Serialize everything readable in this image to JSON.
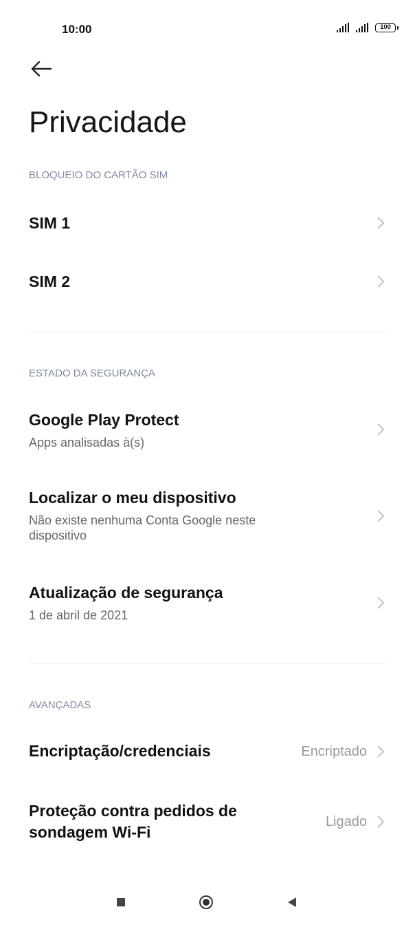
{
  "status_bar": {
    "time": "10:00",
    "battery": "100"
  },
  "page": {
    "title": "Privacidade"
  },
  "sections": {
    "sim_lock": {
      "header": "BLOQUEIO DO CARTÃO SIM",
      "items": [
        {
          "title": "SIM 1"
        },
        {
          "title": "SIM 2"
        }
      ]
    },
    "security_status": {
      "header": "ESTADO DA SEGURANÇA",
      "items": [
        {
          "title": "Google Play Protect",
          "subtitle": "Apps analisadas à(s)"
        },
        {
          "title": "Localizar o meu dispositivo",
          "subtitle": "Não existe nenhuma Conta Google neste dispositivo"
        },
        {
          "title": "Atualização de segurança",
          "subtitle": "1 de abril de 2021"
        }
      ]
    },
    "advanced": {
      "header": "AVANÇADAS",
      "items": [
        {
          "title": "Encriptação/credenciais",
          "value": "Encriptado"
        },
        {
          "title_line1": "Proteção contra pedidos de",
          "title_line2": "sondagem Wi-Fi",
          "value": "Ligado"
        }
      ]
    }
  },
  "icons": {
    "back": "arrow-left-icon",
    "chevron": "chevron-right-icon",
    "nav_recent": "square-icon",
    "nav_home": "circle-icon",
    "nav_back": "triangle-left-icon"
  }
}
